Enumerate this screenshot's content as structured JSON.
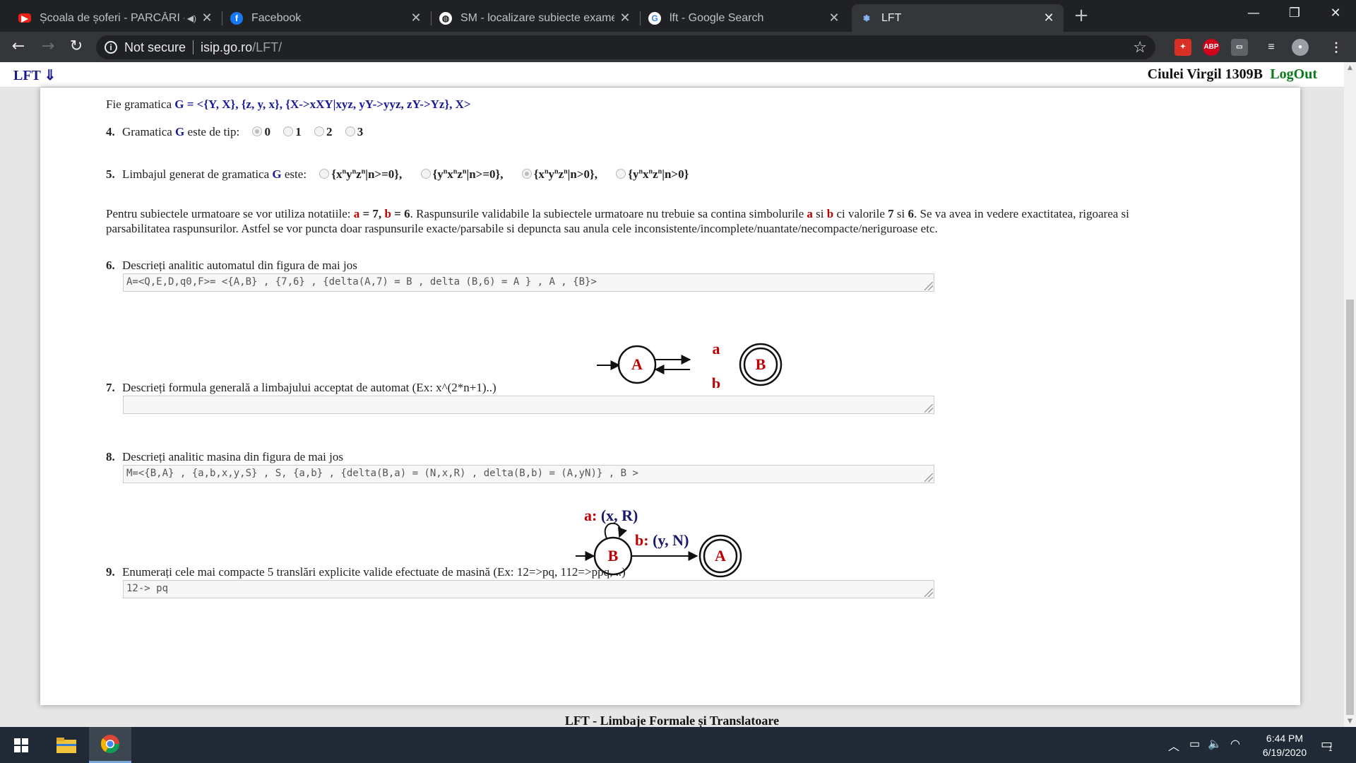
{
  "browser": {
    "tabs": [
      {
        "title": "Școala de șoferi - PARCĂRI -",
        "icon": "youtube-icon",
        "active": false
      },
      {
        "title": "Facebook",
        "icon": "facebook-icon",
        "active": false
      },
      {
        "title": "SM - localizare subiecte examen",
        "icon": "globe-icon",
        "active": false
      },
      {
        "title": "lft - Google Search",
        "icon": "google-icon",
        "active": false
      },
      {
        "title": "LFT",
        "icon": "lft-favicon-icon",
        "active": true
      }
    ],
    "security_label": "Not secure",
    "url_host": "isip.go.ro",
    "url_path": "/LFT/",
    "extensions": [
      "ABP"
    ]
  },
  "header": {
    "app_link": "LFT ⇓",
    "user": "Ciulei Virgil 1309B",
    "logout": "LogOut"
  },
  "grammar": {
    "prefix": "Fie gramatica ",
    "definition": "G = <{Y, X}, {z, y, x}, {X->xXY|xyz, yY->yyz, zY->Yz}, X>"
  },
  "q4": {
    "number": "4.",
    "text_before": "Gramatica ",
    "g": "G",
    "text_after": " este de tip:",
    "options": [
      "0",
      "1",
      "2",
      "3"
    ],
    "selected": "0"
  },
  "q5": {
    "number": "5.",
    "text_before": "Limbajul generat de gramatica ",
    "g": "G",
    "text_after": " este:",
    "selected_index": 2
  },
  "notes": {
    "line1_a": "Pentru subiectele urmatoare se vor utiliza notatiile: ",
    "a_eq": "a",
    "a_val": " = 7, ",
    "b_eq": "b",
    "b_val": " = 6",
    "line1_b": ". Raspunsurile validabile la subiectele urmatoare nu trebuie sa contina simbolurile ",
    "sym_a": "a",
    "si": " si ",
    "sym_b": "b",
    "ci": " ci valorile ",
    "v7": "7",
    "si2": " si ",
    "v6": "6",
    "line1_c": ". Se va avea in vedere exactitatea, rigoarea si",
    "line2": "parsabilitatea raspunsurilor. Astfel se vor puncta doar raspunsurile exacte/parsabile si depuncta sau anula cele inconsistente/incomplete/nuantate/necompacte/neriguroase etc."
  },
  "q6": {
    "number": "6.",
    "label": "Descrieți analitic automatul din figura de mai jos",
    "answer": "A=<Q,E,D,q0,F>= <{A,B} , {7,6} , {delta(A,7) = B , delta (B,6) = A } , A , {B}>",
    "diagram": {
      "state1": "A",
      "state2": "B",
      "edge_top": "a",
      "edge_bottom": "b"
    }
  },
  "q7": {
    "number": "7.",
    "label": "Descrieți formula generală a limbajului acceptat de automat (Ex: x^(2*n+1)..)",
    "answer": ""
  },
  "q8": {
    "number": "8.",
    "label": "Descrieți analitic masina din figura de mai jos",
    "answer": "M=<{B,A} , {a,b,x,y,S} , S, {a,b} , {delta(B,a) = (N,x,R) , delta(B,b) = (A,yN)} , B >",
    "diagram": {
      "state1": "B",
      "state2": "A",
      "loop_in": "a:",
      "loop_out": " (x, R)",
      "edge_in": "b:",
      "edge_out": " (y, N)"
    }
  },
  "q9": {
    "number": "9.",
    "label": "Enumerați cele mai compacte 5 translări explicite valide efectuate de masină (Ex: 12=>pq, 112=>ppq, ..)",
    "answer": "12-> pq"
  },
  "footer": "LFT - Limbaje Formale și Translatoare",
  "taskbar": {
    "time": "6:44 PM",
    "date": "6/19/2020",
    "notifications": "1"
  },
  "colors": {
    "accent_blue": "#1a1a9c",
    "accent_red": "#c00000",
    "logout_green": "#0a7a1a"
  }
}
